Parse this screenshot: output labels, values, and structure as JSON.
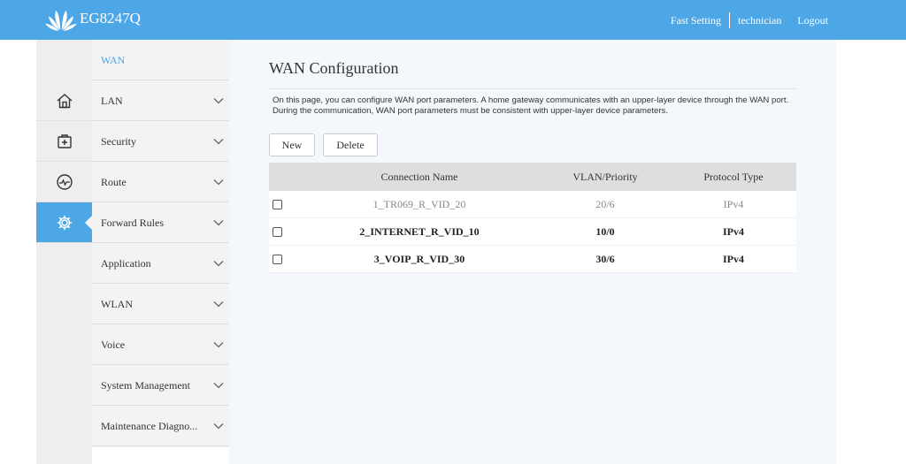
{
  "header": {
    "model": "EG8247Q",
    "fast_setting": "Fast Setting",
    "user": "technician",
    "logout": "Logout"
  },
  "rail": {
    "icons": [
      "home-icon",
      "add-box-icon",
      "pulse-icon",
      "gear-icon"
    ],
    "active_index": 3
  },
  "menu": {
    "items": [
      {
        "label": "WAN",
        "current": true
      },
      {
        "label": "LAN"
      },
      {
        "label": "Security"
      },
      {
        "label": "Route"
      },
      {
        "label": "Forward Rules"
      },
      {
        "label": "Application"
      },
      {
        "label": "WLAN"
      },
      {
        "label": "Voice"
      },
      {
        "label": "System Management"
      },
      {
        "label": "Maintenance Diagno..."
      }
    ]
  },
  "main": {
    "title": "WAN Configuration",
    "description": "On this page, you can configure WAN port parameters. A home gateway communicates with an upper-layer device through the WAN port. During the communication, WAN port parameters must be consistent with upper-layer device parameters.",
    "new_label": "New",
    "delete_label": "Delete",
    "table": {
      "headers": [
        "Connection Name",
        "VLAN/Priority",
        "Protocol Type"
      ],
      "rows": [
        {
          "name": "1_TR069_R_VID_20",
          "vlan": "20/6",
          "protocol": "IPv4"
        },
        {
          "name": "2_INTERNET_R_VID_10",
          "vlan": "10/0",
          "protocol": "IPv4"
        },
        {
          "name": "3_VOIP_R_VID_30",
          "vlan": "30/6",
          "protocol": "IPv4"
        }
      ]
    }
  },
  "colors": {
    "accent": "#4da6e6",
    "rail_bg": "#eeeeee",
    "menu_bg": "#f3f3f3",
    "content_bg": "#f4f8fd"
  }
}
